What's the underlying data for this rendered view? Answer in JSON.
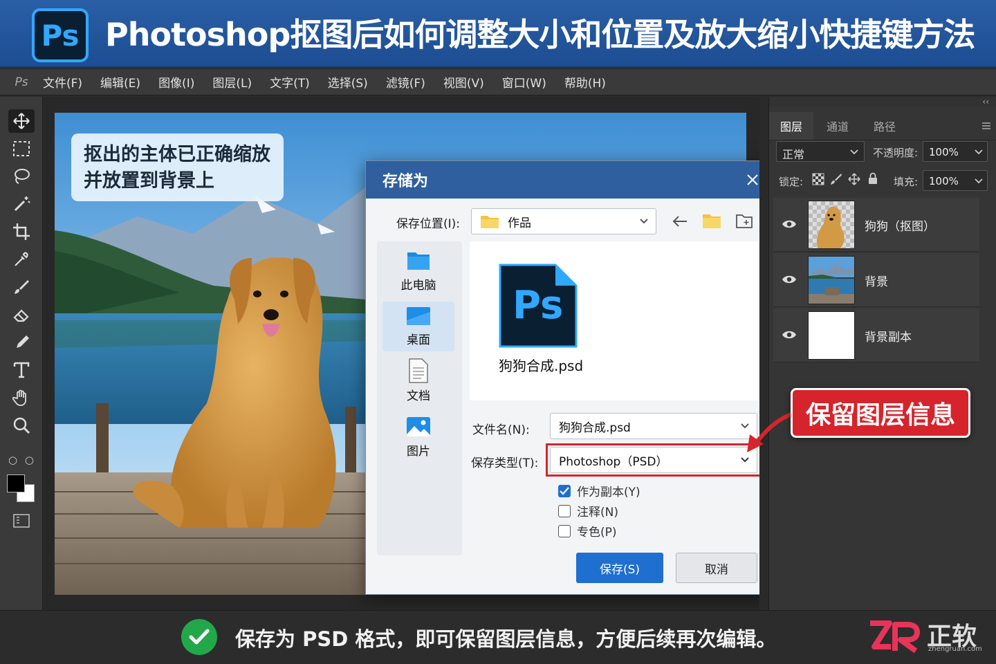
{
  "banner": {
    "logo_text": "Ps",
    "title": "Photoshop抠图后如何调整大小和位置及放大缩小快捷键方法"
  },
  "menubar": {
    "logo": "Ps",
    "items": [
      "文件(F)",
      "编辑(E)",
      "图像(I)",
      "图层(L)",
      "文字(T)",
      "选择(S)",
      "滤镜(F)",
      "视图(V)",
      "窗口(W)",
      "帮助(H)"
    ]
  },
  "toolbar": {
    "tools": [
      "move-tool",
      "marquee-tool",
      "lasso-tool",
      "magic-wand-tool",
      "crop-tool",
      "eyedropper-tool",
      "brush-tool",
      "eraser-tool",
      "pen-tool",
      "type-tool",
      "hand-tool",
      "zoom-tool"
    ],
    "swap_label": "○ ○"
  },
  "canvas": {
    "callout_line1": "抠出的主体已正确缩放",
    "callout_line2": "并放置到背景上"
  },
  "dialog": {
    "title": "存储为",
    "location_label": "保存位置(I):",
    "location_value": "作品",
    "places": [
      {
        "label": "此电脑",
        "icon": "folder-icon"
      },
      {
        "label": "桌面",
        "icon": "desktop-icon",
        "selected": true
      },
      {
        "label": "文档",
        "icon": "document-icon"
      },
      {
        "label": "图片",
        "icon": "picture-icon"
      }
    ],
    "file_item": {
      "icon_text": "Ps",
      "name": "狗狗合成.psd"
    },
    "filename_label": "文件名(N):",
    "filename_value": "狗狗合成.psd",
    "filetype_label": "保存类型(T):",
    "filetype_value": "Photoshop（PSD）",
    "options": [
      {
        "label": "作为副本(Y)",
        "checked": true
      },
      {
        "label": "注释(N)",
        "checked": false
      },
      {
        "label": "专色(P)",
        "checked": false
      }
    ],
    "save_button": "保存(S)",
    "cancel_button": "取消"
  },
  "layers_panel": {
    "tabs": [
      "图层",
      "通道",
      "路径"
    ],
    "blend_mode": "正常",
    "opacity_label": "不透明度:",
    "opacity_value": "100%",
    "lock_label": "锁定:",
    "fill_label": "填充:",
    "fill_value": "100%",
    "collapse": "‹‹",
    "layers": [
      {
        "name": "狗狗（抠图）"
      },
      {
        "name": "背景"
      },
      {
        "name": "背景副本"
      }
    ]
  },
  "badge": "保留图层信息",
  "footer": {
    "message": "保存为 PSD 格式，即可保留图层信息，方便后续再次编辑。",
    "brand_name": "正软",
    "brand_url": "zhengruan.com"
  },
  "colors": {
    "accent": "#1f6fd1",
    "badge": "#d6242c",
    "ps_blue": "#31a8ff",
    "banner": "#2a5fa6",
    "check": "#22a84b"
  }
}
